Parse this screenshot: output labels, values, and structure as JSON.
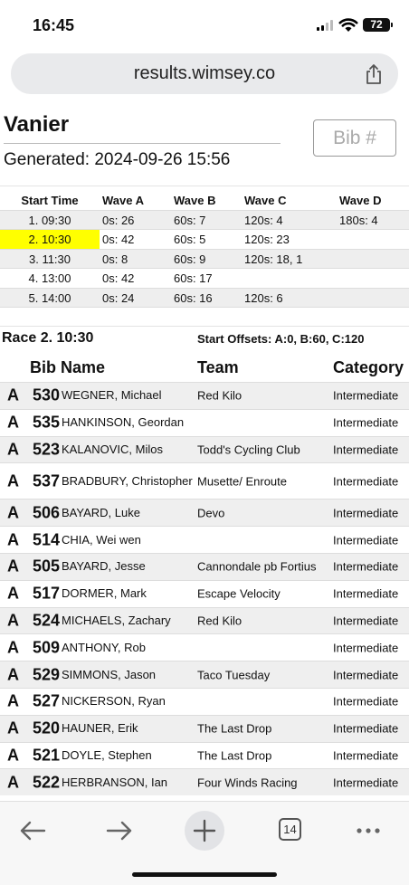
{
  "status": {
    "time": "16:45",
    "battery": "72"
  },
  "browser": {
    "url": "results.wimsey.co",
    "tab_count": "14"
  },
  "page": {
    "title": "Vanier",
    "generated": "Generated: 2024-09-26 15:56",
    "bib_placeholder": "Bib #"
  },
  "schedule": {
    "headers": [
      "Start Time",
      "Wave A",
      "Wave B",
      "Wave C",
      "Wave D"
    ],
    "rows": [
      {
        "start": "1. 09:30",
        "a": "0s: 26",
        "b": "60s: 7",
        "c": "120s: 4",
        "d": "180s: 4"
      },
      {
        "start": "2. 10:30",
        "a": "0s: 42",
        "b": "60s: 5",
        "c": "120s: 23",
        "d": ""
      },
      {
        "start": "3. 11:30",
        "a": "0s: 8",
        "b": "60s: 9",
        "c": "120s: 18, 1",
        "d": ""
      },
      {
        "start": "4. 13:00",
        "a": "0s: 42",
        "b": "60s: 17",
        "c": "",
        "d": ""
      },
      {
        "start": "5. 14:00",
        "a": "0s: 24",
        "b": "60s: 16",
        "c": "120s: 6",
        "d": ""
      }
    ],
    "highlight_color": "#ffff00"
  },
  "race": {
    "title": "Race 2. 10:30",
    "offsets": "Start Offsets: A:0, B:60, C:120",
    "headers": {
      "bib": "Bib",
      "name": "Name",
      "team": "Team",
      "category": "Category"
    },
    "entries": [
      {
        "wave": "A",
        "bib": "530",
        "name": "WEGNER, Michael",
        "team": "Red Kilo",
        "category": "Intermediate"
      },
      {
        "wave": "A",
        "bib": "535",
        "name": "HANKINSON, Geordan",
        "team": "",
        "category": "Intermediate"
      },
      {
        "wave": "A",
        "bib": "523",
        "name": "KALANOVIC, Milos",
        "team": "Todd's Cycling Club",
        "category": "Intermediate"
      },
      {
        "wave": "A",
        "bib": "537",
        "name": "BRADBURY, Christopher",
        "team": "Musette/ Enroute",
        "category": "Intermediate"
      },
      {
        "wave": "A",
        "bib": "506",
        "name": "BAYARD, Luke",
        "team": "Devo",
        "category": "Intermediate"
      },
      {
        "wave": "A",
        "bib": "514",
        "name": "CHIA, Wei wen",
        "team": "",
        "category": "Intermediate"
      },
      {
        "wave": "A",
        "bib": "505",
        "name": "BAYARD, Jesse",
        "team": "Cannondale pb Fortius",
        "category": "Intermediate"
      },
      {
        "wave": "A",
        "bib": "517",
        "name": "DORMER, Mark",
        "team": "Escape Velocity",
        "category": "Intermediate"
      },
      {
        "wave": "A",
        "bib": "524",
        "name": "MICHAELS, Zachary",
        "team": "Red Kilo",
        "category": "Intermediate"
      },
      {
        "wave": "A",
        "bib": "509",
        "name": "ANTHONY, Rob",
        "team": "",
        "category": "Intermediate"
      },
      {
        "wave": "A",
        "bib": "529",
        "name": "SIMMONS, Jason",
        "team": "Taco Tuesday",
        "category": "Intermediate"
      },
      {
        "wave": "A",
        "bib": "527",
        "name": "NICKERSON, Ryan",
        "team": "",
        "category": "Intermediate"
      },
      {
        "wave": "A",
        "bib": "520",
        "name": "HAUNER, Erik",
        "team": "The Last Drop",
        "category": "Intermediate"
      },
      {
        "wave": "A",
        "bib": "521",
        "name": "DOYLE, Stephen",
        "team": "The Last Drop",
        "category": "Intermediate"
      },
      {
        "wave": "A",
        "bib": "522",
        "name": "HERBRANSON, Ian",
        "team": "Four Winds Racing",
        "category": "Intermediate"
      }
    ]
  }
}
